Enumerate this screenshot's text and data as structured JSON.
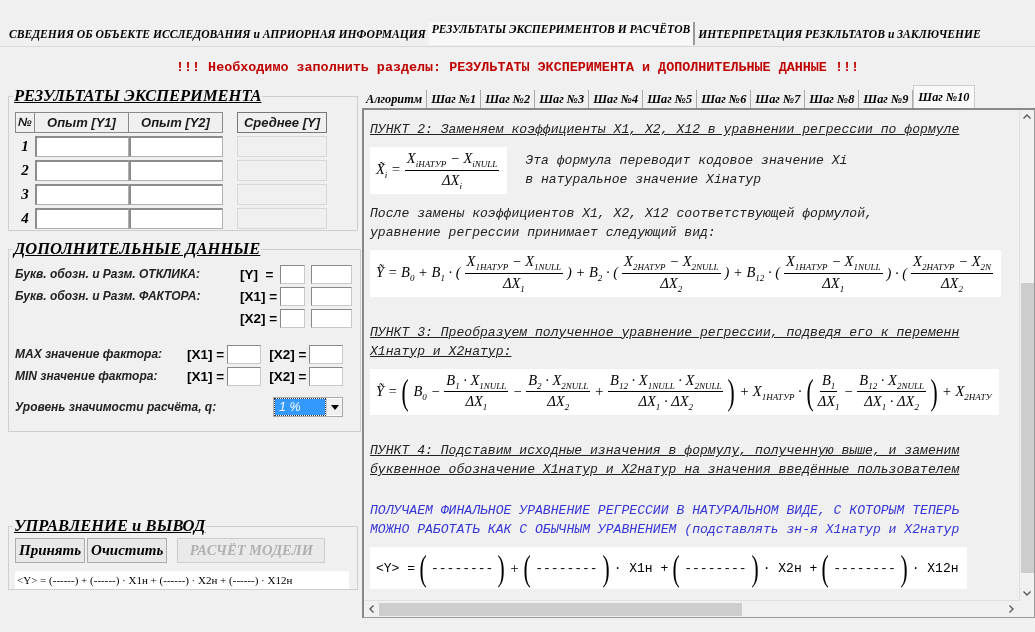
{
  "main_tabs": [
    {
      "label": "СВЕДЕНИЯ ОБ ОБЪЕКТЕ ИССЛЕДОВАНИЯ и АПРИОРНАЯ ИНФОРМАЦИЯ",
      "selected": false
    },
    {
      "label": "РЕЗУЛЬТАТЫ ЭКСПЕРИМЕНТОВ И РАСЧЁТОВ",
      "selected": true
    },
    {
      "label": "ИНТЕРПРЕТАЦИЯ РЕЗКЛЬТАТОВ и ЗАКЛЮЧЕНИЕ",
      "selected": false
    }
  ],
  "warning": "!!! Необходимо заполнить разделы: РЕЗУЛЬТАТЫ ЭКСПЕРИМЕНТА и ДОПОЛНИТЕЛЬНЫЕ ДАННЫЕ !!!",
  "results": {
    "title": "РЕЗУЛЬТАТЫ ЭКСПЕРИМЕНТА",
    "columns": [
      "№",
      "Опыт [Y1]",
      "Опыт [Y2]"
    ],
    "mean_column": "Среднее [Y]",
    "rows": [
      "1",
      "2",
      "3",
      "4"
    ]
  },
  "additional": {
    "title": "ДОПОЛНИТЕЛЬНЫЕ ДАННЫЕ",
    "response": {
      "label": "Букв. обозн. и Разм. ОТКЛИКА:",
      "symbol": "[Y]  ="
    },
    "factor": {
      "label": "Букв. обозн. и Разм. ФАКТОРА:",
      "symbols": [
        "[X1] =",
        "[X2] ="
      ]
    },
    "limits": [
      {
        "label": "MAX значение фактора:",
        "symbols": [
          "[X1] =",
          "[X2] ="
        ]
      },
      {
        "label": "MIN значение фактора:",
        "symbols": [
          "[X1] =",
          "[X2] ="
        ]
      }
    ],
    "significance": {
      "label": "Уровень значимости расчёта, q:",
      "value": "1 %"
    }
  },
  "control": {
    "title": "УПРАВЛЕНИЕ и ВЫВОД",
    "buttons": [
      {
        "label": "Принять",
        "disabled": false
      },
      {
        "label": "Очистить",
        "disabled": false
      },
      {
        "label": "РАСЧЁТ МОДЕЛИ",
        "disabled": true
      }
    ],
    "formula": "<Y> = (------) + (------) · X1н + (------) · X2н + (------) · X12н"
  },
  "step_tabs": [
    {
      "label": "Алгоритм",
      "selected": false
    },
    {
      "label": "Шаг №1",
      "selected": false
    },
    {
      "label": "Шаг №2",
      "selected": false
    },
    {
      "label": "Шаг №3",
      "selected": false
    },
    {
      "label": "Шаг №4",
      "selected": false
    },
    {
      "label": "Шаг №5",
      "selected": false
    },
    {
      "label": "Шаг №6",
      "selected": false
    },
    {
      "label": "Шаг №7",
      "selected": false
    },
    {
      "label": "Шаг №8",
      "selected": false
    },
    {
      "label": "Шаг №9",
      "selected": false
    },
    {
      "label": "Шаг №10",
      "selected": true
    }
  ],
  "content": [
    {
      "kind": "heading",
      "lines": [
        "ПУНКТ 2: Заменяем коэффициенты X1, X2, X12 в уравнении регрессии по формуле"
      ]
    },
    {
      "kind": "formula",
      "tokens": [
        {
          "kind": "t",
          "text": "X̃$_{i}$ ="
        },
        {
          "kind": "frac",
          "num": "X$_{iНАТУР}$ − X$_{iNULL}$",
          "den": "ΔX$_{i}$"
        }
      ],
      "note": [
        "Эта формула переводит кодовое значение Xi",
        "в натуральное значение Xiнатур"
      ]
    },
    {
      "kind": "paragraph",
      "lines": [
        "После замены коэффициентов X1, X2, X12 соответствующей формулой,",
        "уравнение регрессии принимает следующий вид:"
      ]
    },
    {
      "kind": "formula",
      "tokens": [
        {
          "kind": "t",
          "text": "Ỹ = B$_{0}$ + B$_{1}$ · ("
        },
        {
          "kind": "frac",
          "num": "X$_{1НАТУР}$ − X$_{1NULL}$",
          "den": "ΔX$_{1}$"
        },
        {
          "kind": "t",
          "text": ") + B$_{2}$ · ("
        },
        {
          "kind": "frac",
          "num": "X$_{2НАТУР}$ − X$_{2NULL}$",
          "den": "ΔX$_{2}$"
        },
        {
          "kind": "t",
          "text": ") + B$_{12}$ · ("
        },
        {
          "kind": "frac",
          "num": "X$_{1НАТУР}$ − X$_{1NULL}$",
          "den": "ΔX$_{1}$"
        },
        {
          "kind": "t",
          "text": ") · ("
        },
        {
          "kind": "frac",
          "num": "X$_{2НАТУР}$ − X$_{2N}$",
          "den": "ΔX$_{2}$"
        }
      ]
    },
    {
      "kind": "heading",
      "lines": [
        "ПУНКТ 3: Преобразуем полученное уравнение регрессии, подведя его к переменн",
        "X1натур и X2натур:"
      ]
    },
    {
      "kind": "formula",
      "tokens": [
        {
          "kind": "t",
          "text": "Ỹ ="
        },
        {
          "kind": "paren",
          "text": "("
        },
        {
          "kind": "t",
          "text": "B$_{0}$ −"
        },
        {
          "kind": "frac",
          "num": "B$_{1}$ · X$_{1NULL}$",
          "den": "ΔX$_{1}$"
        },
        {
          "kind": "t",
          "text": "−"
        },
        {
          "kind": "frac",
          "num": "B$_{2}$ · X$_{2NULL}$",
          "den": "ΔX$_{2}$"
        },
        {
          "kind": "t",
          "text": "+"
        },
        {
          "kind": "frac",
          "num": "B$_{12}$ · X$_{1NULL}$ · X$_{2NULL}$",
          "den": "ΔX$_{1}$ · ΔX$_{2}$"
        },
        {
          "kind": "paren",
          "text": ")"
        },
        {
          "kind": "t",
          "text": "+ X$_{1НАТУР}$ ·"
        },
        {
          "kind": "paren",
          "text": "("
        },
        {
          "kind": "frac",
          "num": "B$_{1}$",
          "den": "ΔX$_{1}$"
        },
        {
          "kind": "t",
          "text": "−"
        },
        {
          "kind": "frac",
          "num": "B$_{12}$ · X$_{2NULL}$",
          "den": "ΔX$_{1}$ · ΔX$_{2}$"
        },
        {
          "kind": "paren",
          "text": ")"
        },
        {
          "kind": "t",
          "text": "+ X$_{2НАТУ}$"
        }
      ]
    },
    {
      "kind": "heading",
      "lines": [
        "ПУНКТ 4: Подставим исходные изначения в формулу, полученную выше, и заменим",
        "буквенное обозначение X1натур и X2натур на значения введённые пользователем"
      ]
    },
    {
      "kind": "result",
      "lines": [
        "ПОЛУЧАЕМ ФИНАЛЬНОЕ УРАВНЕНИЕ РЕГРЕССИИ В НАТУРАЛЬНОМ ВИДЕ, С КОТОРЫМ ТЕПЕРЬ",
        "МОЖНО РАБОТАТЬ КАК С ОБЫЧНЫМ УРАВНЕНИЕМ (подставлять зн-я X1натур и X2натур"
      ]
    },
    {
      "kind": "formula",
      "tokens": [
        {
          "kind": "m",
          "text": "<Y> ="
        },
        {
          "kind": "paren",
          "text": "("
        },
        {
          "kind": "m",
          "text": "--------"
        },
        {
          "kind": "paren",
          "text": ")"
        },
        {
          "kind": "t",
          "text": "+"
        },
        {
          "kind": "paren",
          "text": "("
        },
        {
          "kind": "m",
          "text": "--------"
        },
        {
          "kind": "paren",
          "text": ")"
        },
        {
          "kind": "m",
          "text": "· X1н +"
        },
        {
          "kind": "paren",
          "text": "("
        },
        {
          "kind": "m",
          "text": "--------"
        },
        {
          "kind": "paren",
          "text": ")"
        },
        {
          "kind": "m",
          "text": "· X2н +"
        },
        {
          "kind": "paren",
          "text": "("
        },
        {
          "kind": "m",
          "text": "--------"
        },
        {
          "kind": "paren",
          "text": ")"
        },
        {
          "kind": "m",
          "text": "· X12н"
        }
      ]
    }
  ]
}
